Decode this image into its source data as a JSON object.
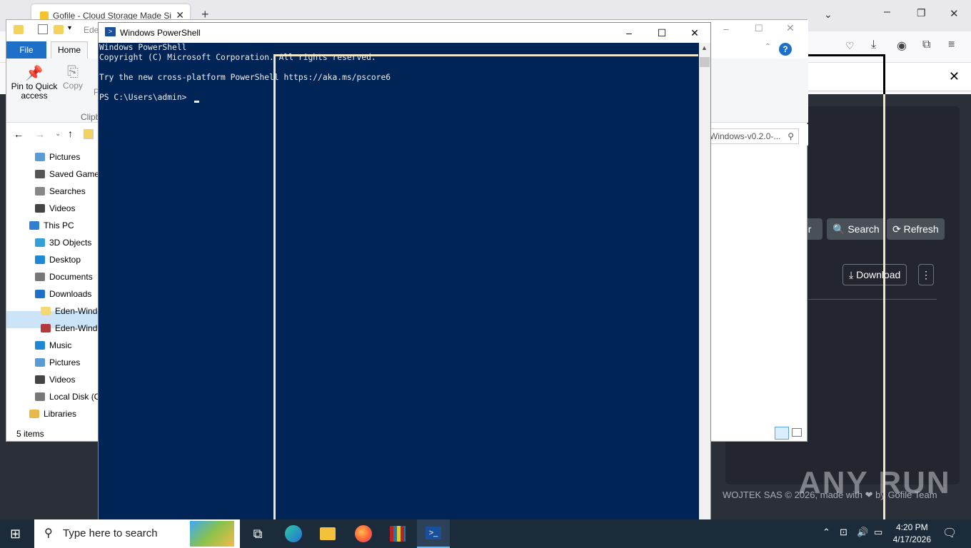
{
  "browser": {
    "tab_title": "Gofile - Cloud Storage Made Si",
    "search_button": "Search",
    "refresh_button": "Refresh",
    "partial_button": "er",
    "download_button": "Download",
    "footer": "WOJTEK SAS © 2026, made with ❤ by Gofile Team",
    "watermark": "ANY RUN"
  },
  "explorer": {
    "addr_partial": "Ede",
    "tab_file": "File",
    "tab_home": "Home",
    "ribbon_pin": "Pin to Quick access",
    "ribbon_copy": "Copy",
    "ribbon_p": "P",
    "ribbon_group": "Clipb",
    "search_text": "Windows-v0.2.0-...",
    "status": "5 items",
    "tree": [
      {
        "label": "Pictures",
        "color": "#5b9bd5"
      },
      {
        "label": "Saved Games",
        "color": "#555"
      },
      {
        "label": "Searches",
        "color": "#888"
      },
      {
        "label": "Videos",
        "color": "#444"
      },
      {
        "label": "This PC",
        "color": "#2f7fd3"
      },
      {
        "label": "3D Objects",
        "color": "#33a0d8"
      },
      {
        "label": "Desktop",
        "color": "#1e88d6"
      },
      {
        "label": "Documents",
        "color": "#777"
      },
      {
        "label": "Downloads",
        "color": "#1e70c8"
      },
      {
        "label": "Eden-Windo",
        "color": "#f7d774"
      },
      {
        "label": "Eden-Windo",
        "color": "#b23a3a"
      },
      {
        "label": "Music",
        "color": "#1e88d6"
      },
      {
        "label": "Pictures",
        "color": "#5b9bd5"
      },
      {
        "label": "Videos",
        "color": "#444"
      },
      {
        "label": "Local Disk (C",
        "color": "#777"
      },
      {
        "label": "Libraries",
        "color": "#e8b84b"
      }
    ]
  },
  "powershell": {
    "title": "Windows PowerShell",
    "lines": [
      "Windows PowerShell",
      "Copyright (C) Microsoft Corporation. All rights reserved.",
      "",
      "Try the new cross-platform PowerShell https://aka.ms/pscore6",
      "",
      "PS C:\\Users\\admin> "
    ]
  },
  "taskbar": {
    "search_placeholder": "Type here to search",
    "time": "4:20 PM",
    "date": "4/17/2026"
  }
}
